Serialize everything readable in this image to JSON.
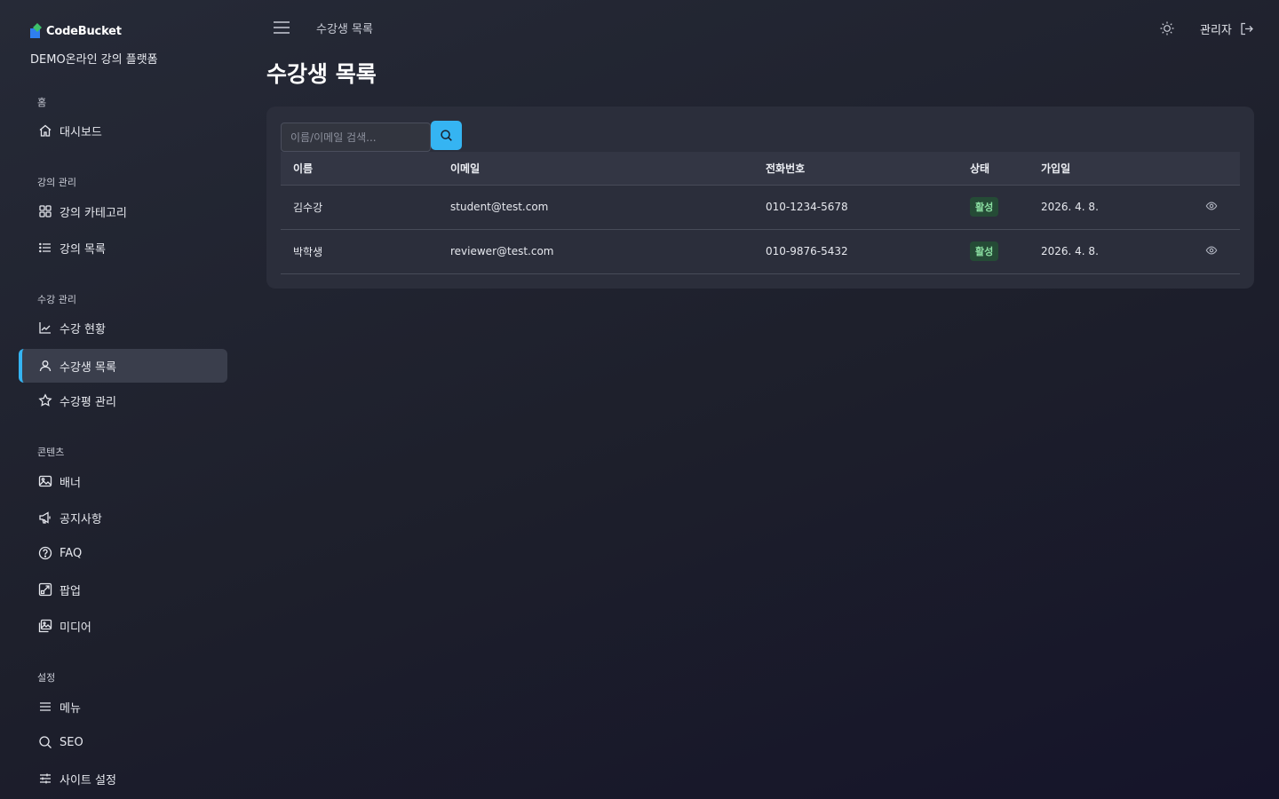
{
  "brand": {
    "logo_text": "CodeBucket",
    "site_name": "DEMO온라인 강의 플랫폼"
  },
  "sidebar": {
    "sections": [
      {
        "title": "홈",
        "items": [
          {
            "label": "대시보드",
            "icon": "home-icon"
          }
        ]
      },
      {
        "title": "강의 관리",
        "items": [
          {
            "label": "강의 카테고리",
            "icon": "grid-icon"
          },
          {
            "label": "강의 목록",
            "icon": "list-icon"
          }
        ]
      },
      {
        "title": "수강 관리",
        "items": [
          {
            "label": "수강 현황",
            "icon": "chart-icon"
          },
          {
            "label": "수강생 목록",
            "icon": "user-icon",
            "active": true
          },
          {
            "label": "수강평 관리",
            "icon": "star-icon"
          }
        ]
      },
      {
        "title": "콘텐츠",
        "items": [
          {
            "label": "배너",
            "icon": "image-icon"
          },
          {
            "label": "공지사항",
            "icon": "megaphone-icon"
          },
          {
            "label": "FAQ",
            "icon": "help-circle-icon"
          },
          {
            "label": "팝업",
            "icon": "popup-icon"
          },
          {
            "label": "미디어",
            "icon": "media-icon"
          }
        ]
      },
      {
        "title": "설정",
        "items": [
          {
            "label": "메뉴",
            "icon": "menu-icon"
          },
          {
            "label": "SEO",
            "icon": "search-icon"
          },
          {
            "label": "사이트 설정",
            "icon": "sliders-icon"
          }
        ]
      }
    ]
  },
  "header": {
    "breadcrumb": "수강생 목록",
    "user_label": "관리자"
  },
  "page": {
    "title": "수강생 목록"
  },
  "search": {
    "placeholder": "이름/이메일 검색..."
  },
  "table": {
    "columns": [
      "이름",
      "이메일",
      "전화번호",
      "상태",
      "가입일",
      ""
    ],
    "rows": [
      {
        "name": "김수강",
        "email": "student@test.com",
        "phone": "010-1234-5678",
        "status": "활성",
        "joined": "2026. 4. 8."
      },
      {
        "name": "박학생",
        "email": "reviewer@test.com",
        "phone": "010-9876-5432",
        "status": "활성",
        "joined": "2026. 4. 8."
      }
    ]
  },
  "colors": {
    "accent": "#35b4f2",
    "badge_bg": "#254b36",
    "badge_text": "#8ce0a3"
  }
}
